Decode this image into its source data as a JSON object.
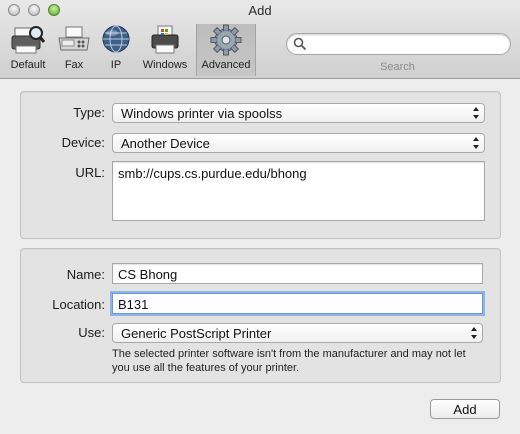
{
  "window": {
    "title": "Add"
  },
  "toolbar": {
    "items": [
      {
        "label": "Default",
        "icon": "printer-magnifier-icon"
      },
      {
        "label": "Fax",
        "icon": "fax-icon"
      },
      {
        "label": "IP",
        "icon": "globe-icon"
      },
      {
        "label": "Windows",
        "icon": "windows-printer-icon"
      },
      {
        "label": "Advanced",
        "icon": "gear-icon",
        "selected": true
      }
    ],
    "search": {
      "value": "",
      "caption": "Search"
    }
  },
  "connection": {
    "type_label": "Type:",
    "type_value": "Windows printer via spoolss",
    "device_label": "Device:",
    "device_value": "Another Device",
    "url_label": "URL:",
    "url_value": "smb://cups.cs.purdue.edu/bhong"
  },
  "printer": {
    "name_label": "Name:",
    "name_value": "CS Bhong",
    "location_label": "Location:",
    "location_value": "B131",
    "use_label": "Use:",
    "use_value": "Generic PostScript Printer",
    "note": "The selected printer software isn't from the manufacturer and may not let you use all the features of your printer."
  },
  "footer": {
    "add_label": "Add"
  },
  "colors": {
    "accent_focus": "#8fb5e6",
    "close_green": "#5aa62e"
  }
}
